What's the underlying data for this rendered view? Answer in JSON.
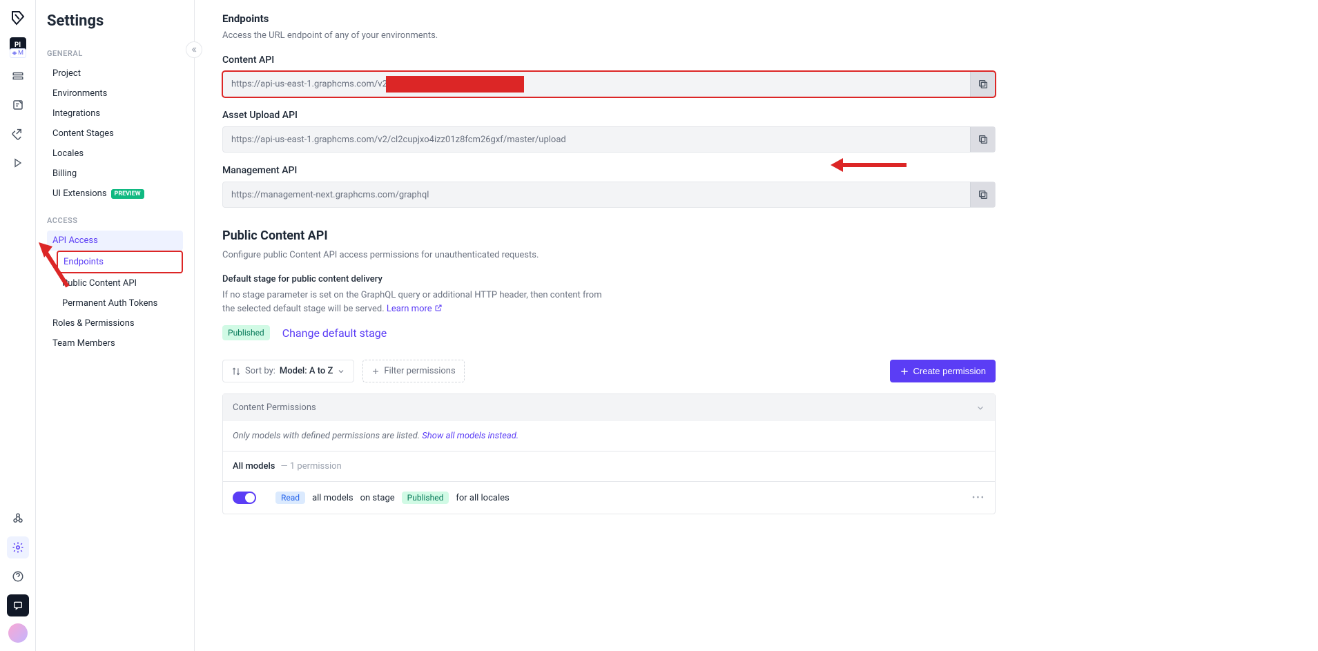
{
  "iconbar": {
    "project_badge": "PI",
    "env_badge": "M"
  },
  "sidebar": {
    "title": "Settings",
    "sections": {
      "general": {
        "label": "GENERAL",
        "items": [
          "Project",
          "Environments",
          "Integrations",
          "Content Stages",
          "Locales",
          "Billing",
          "UI Extensions"
        ],
        "preview_badge": "PREVIEW"
      },
      "access": {
        "label": "ACCESS",
        "items": [
          "API Access",
          "Roles & Permissions",
          "Team Members"
        ],
        "api_sub": [
          "Endpoints",
          "Public Content API",
          "Permanent Auth Tokens"
        ]
      }
    }
  },
  "endpoints": {
    "title": "Endpoints",
    "desc": "Access the URL endpoint of any of your environments.",
    "content_api": {
      "label": "Content API",
      "url_prefix": "https://api-us-east-1.graphcms.com/v2"
    },
    "asset_api": {
      "label": "Asset Upload API",
      "url": "https://api-us-east-1.graphcms.com/v2/cl2cupjxo4izz01z8fcm26gxf/master/upload"
    },
    "mgmt_api": {
      "label": "Management API",
      "url": "https://management-next.graphcms.com/graphql"
    }
  },
  "public_api": {
    "title": "Public Content API",
    "desc": "Configure public Content API access permissions for unauthenticated requests.",
    "stage_label": "Default stage for public content delivery",
    "stage_desc": "If no stage parameter is set on the GraphQL query or additional HTTP header, then content from the selected default stage will be served. ",
    "learn_more": "Learn more",
    "published_badge": "Published",
    "change_stage": "Change default stage",
    "sort_prefix": "Sort by: ",
    "sort_value": "Model: A to Z",
    "filter_label": "Filter permissions",
    "create_label": "Create permission",
    "panel_title": "Content Permissions",
    "panel_note_a": "Only models with defined permissions are listed. ",
    "panel_note_link": "Show all models instead.",
    "all_models": "All models",
    "perm_count": "— 1 permission",
    "read_badge": "Read",
    "perm_text_a": "all models",
    "perm_text_b": "on stage",
    "perm_text_c": "for all locales"
  }
}
